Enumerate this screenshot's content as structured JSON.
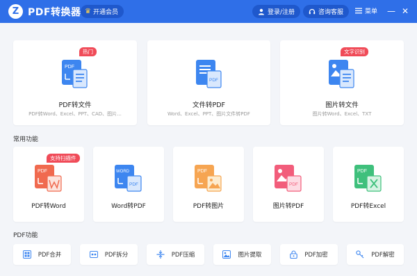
{
  "app": {
    "logo_letter": "Z",
    "title": "PDF转换器",
    "vip_label": "开通会员"
  },
  "titlebar": {
    "login_label": "登录/注册",
    "service_label": "咨询客服",
    "menu_label": "菜单",
    "minimize": "—",
    "close": "✕"
  },
  "featured": [
    {
      "name": "PDF转文件",
      "desc": "PDF转Word、Excel、PPT、CAD、图片...",
      "badge": "热门",
      "icon": "pdf-to-file-icon"
    },
    {
      "name": "文件转PDF",
      "desc": "Word、Excel、PPT、图片文件转PDF",
      "badge": "",
      "icon": "file-to-pdf-icon"
    },
    {
      "name": "图片转文件",
      "desc": "图片转Word、Excel、TXT",
      "badge": "文字识别",
      "icon": "image-to-file-icon"
    }
  ],
  "common": {
    "title": "常用功能",
    "items": [
      {
        "name": "PDF转Word",
        "badge": "支持扫描件",
        "icon": "pdf-to-word-icon"
      },
      {
        "name": "Word转PDF",
        "badge": "",
        "icon": "word-to-pdf-icon"
      },
      {
        "name": "PDF转图片",
        "badge": "",
        "icon": "pdf-to-image-icon"
      },
      {
        "name": "图片转PDF",
        "badge": "",
        "icon": "image-to-pdf-icon"
      },
      {
        "name": "PDF转Excel",
        "badge": "",
        "icon": "pdf-to-excel-icon"
      }
    ]
  },
  "pdf_tools": {
    "title": "PDF功能",
    "items": [
      {
        "name": "PDF合并",
        "icon": "merge-icon"
      },
      {
        "name": "PDF拆分",
        "icon": "split-icon"
      },
      {
        "name": "PDF压缩",
        "icon": "compress-icon"
      },
      {
        "name": "图片提取",
        "icon": "image-extract-icon"
      },
      {
        "name": "PDF加密",
        "icon": "lock-icon"
      },
      {
        "name": "PDF解密",
        "icon": "key-icon"
      }
    ]
  },
  "colors": {
    "titlebar": "#2f6fe8",
    "badge": "#f04b58",
    "blue": "#3d86f0",
    "red": "#f06a4f",
    "orange": "#f6a552",
    "pink": "#f25d7b",
    "green": "#3fc07c"
  },
  "icon_text": {
    "pdf": "PDF",
    "word": "WORD"
  }
}
